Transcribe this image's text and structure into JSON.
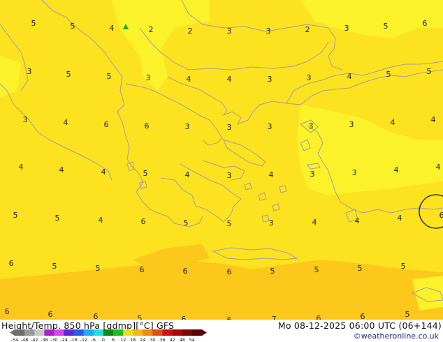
{
  "header": {
    "title": "Height/Temp. 850 hPa [gdmp][°C] GFS",
    "datetime": "Mo 08-12-2025 06:00 UTC (06+144)",
    "credit": "©weatheronline.co.uk"
  },
  "colors": {
    "sea_background": "#fde21f",
    "land_fill": "#f9e41e",
    "light_yellow": "#fbf22a",
    "orange_patch": "#fbc81b",
    "coastline": "#a0a0a0",
    "contour_marker": "#111111",
    "green_marker": "#22aa22"
  },
  "map": {
    "region": "Balkans / Aegean Sea",
    "temperature_values": [
      "5",
      "5",
      "4",
      "2",
      "2",
      "3",
      "3",
      "2",
      "3",
      "5",
      "6",
      "3",
      "5",
      "5",
      "3",
      "4",
      "4",
      "3",
      "3",
      "4",
      "5",
      "5",
      "3",
      "4",
      "6",
      "6",
      "3",
      "3",
      "3",
      "3",
      "3",
      "4",
      "4",
      "4",
      "4",
      "4",
      "5",
      "4",
      "3",
      "4",
      "3",
      "3",
      "4",
      "4",
      "5",
      "5",
      "4",
      "6",
      "5",
      "5",
      "3",
      "4",
      "4",
      "4",
      "6",
      "6",
      "5",
      "5",
      "6",
      "6",
      "6",
      "5",
      "5",
      "5",
      "5",
      "6",
      "6",
      "6",
      "5",
      "6",
      "6",
      "7",
      "6",
      "6",
      "5"
    ]
  },
  "legend": {
    "tick_labels": [
      "-54",
      "-48",
      "-42",
      "-38",
      "-30",
      "-24",
      "-18",
      "-12",
      "-6",
      "0",
      "6",
      "12",
      "18",
      "24",
      "30",
      "36",
      "42",
      "48",
      "54"
    ],
    "colors": [
      "#6e6e6e",
      "#9a9a9a",
      "#c8c8c8",
      "#aa22cc",
      "#dd44ee",
      "#5a2ad2",
      "#2a5ce6",
      "#22aaee",
      "#22dddd",
      "#118811",
      "#22bb22",
      "#eedd22",
      "#f4b81a",
      "#f08a10",
      "#e05010",
      "#cc1111",
      "#aa0808",
      "#800404",
      "#5a0202"
    ]
  }
}
